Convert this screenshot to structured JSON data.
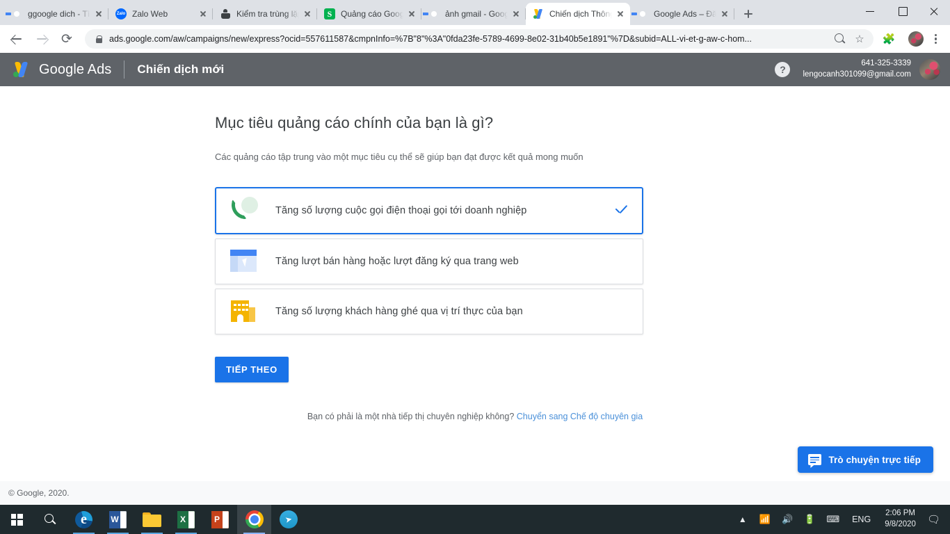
{
  "browser": {
    "tabs": [
      {
        "title": "ggoogle dich - Tìm",
        "favicon": "google-g-icon",
        "active": false
      },
      {
        "title": "Zalo Web",
        "favicon": "zalo-icon",
        "active": false
      },
      {
        "title": "Kiểm tra trùng lặp",
        "favicon": "duplicate-check-icon",
        "active": false
      },
      {
        "title": "Quảng cáo Google",
        "favicon": "s-green-icon",
        "active": false
      },
      {
        "title": "ảnh gmail - Googl",
        "favicon": "google-g-icon",
        "active": false
      },
      {
        "title": "Chiến dịch Thông",
        "favicon": "google-ads-icon",
        "active": true
      },
      {
        "title": "Google Ads – Đăn",
        "favicon": "google-g-icon",
        "active": false
      }
    ],
    "new_tab_label": "+",
    "window_controls": {
      "minimize": "–",
      "maximize": "□",
      "close": "✕"
    },
    "toolbar": {
      "back": "←",
      "forward": "→",
      "reload": "⟳",
      "url": "ads.google.com/aw/campaigns/new/express?ocid=557611587&cmpnInfo=%7B\"8\"%3A\"0fda23fe-5789-4699-8e02-31b40b5e1891\"%7D&subid=ALL-vi-et-g-aw-c-hom...",
      "lock": "secure-lock-icon"
    }
  },
  "ads_header": {
    "brand": "Google Ads",
    "page_title": "Chiến dịch mới",
    "help_label": "?",
    "account_phone": "641-325-3339",
    "account_email": "lengocanh301099@gmail.com"
  },
  "main": {
    "headline": "Mục tiêu quảng cáo chính của bạn là gì?",
    "subhead": "Các quảng cáo tập trung vào một mục tiêu cụ thể sẽ giúp bạn đạt được kết quả mong muốn",
    "options": [
      {
        "label": "Tăng số lượng cuộc gọi điện thoại gọi tới doanh nghiệp",
        "icon": "phone-call-icon",
        "selected": true
      },
      {
        "label": "Tăng lượt bán hàng hoặc lượt đăng ký qua trang web",
        "icon": "website-cursor-icon",
        "selected": false
      },
      {
        "label": "Tăng số lượng khách hàng ghé qua vị trí thực của bạn",
        "icon": "store-building-icon",
        "selected": false
      }
    ],
    "next_button": "TIẾP THEO",
    "expert_question": "Bạn có phải là một nhà tiếp thị chuyên nghiệp không?",
    "expert_link": "Chuyển sang Chế độ chuyên gia",
    "chat_button": "Trò chuyện trực tiếp",
    "footer": "© Google, 2020."
  },
  "colors": {
    "accent_blue": "#1a73e8",
    "header_gray": "#5f6368",
    "selected_border": "#1a73e8",
    "link_blue": "#4a90d9",
    "call_green": "#2e9e5b",
    "store_yellow": "#f4b400"
  },
  "taskbar": {
    "start": "windows-start-icon",
    "search": "search-icon",
    "apps": [
      {
        "name": "microsoft-edge",
        "icon": "edge-icon",
        "state": "open"
      },
      {
        "name": "microsoft-word",
        "icon": "word-icon",
        "state": "open"
      },
      {
        "name": "file-explorer",
        "icon": "folder-icon",
        "state": "open"
      },
      {
        "name": "microsoft-excel",
        "icon": "excel-icon",
        "state": "open"
      },
      {
        "name": "microsoft-powerpoint",
        "icon": "powerpoint-icon",
        "state": "closed"
      },
      {
        "name": "google-chrome",
        "icon": "chrome-icon",
        "state": "active"
      },
      {
        "name": "telegram",
        "icon": "telegram-icon",
        "state": "closed"
      }
    ],
    "tray": {
      "chevron": "▲",
      "network": "wifi-icon",
      "volume": "speaker-icon",
      "battery": "battery-charging-icon",
      "keyboard": "keyboard-icon",
      "language": "ENG",
      "time": "2:06 PM",
      "date": "9/8/2020",
      "notifications": "notification-icon"
    }
  }
}
